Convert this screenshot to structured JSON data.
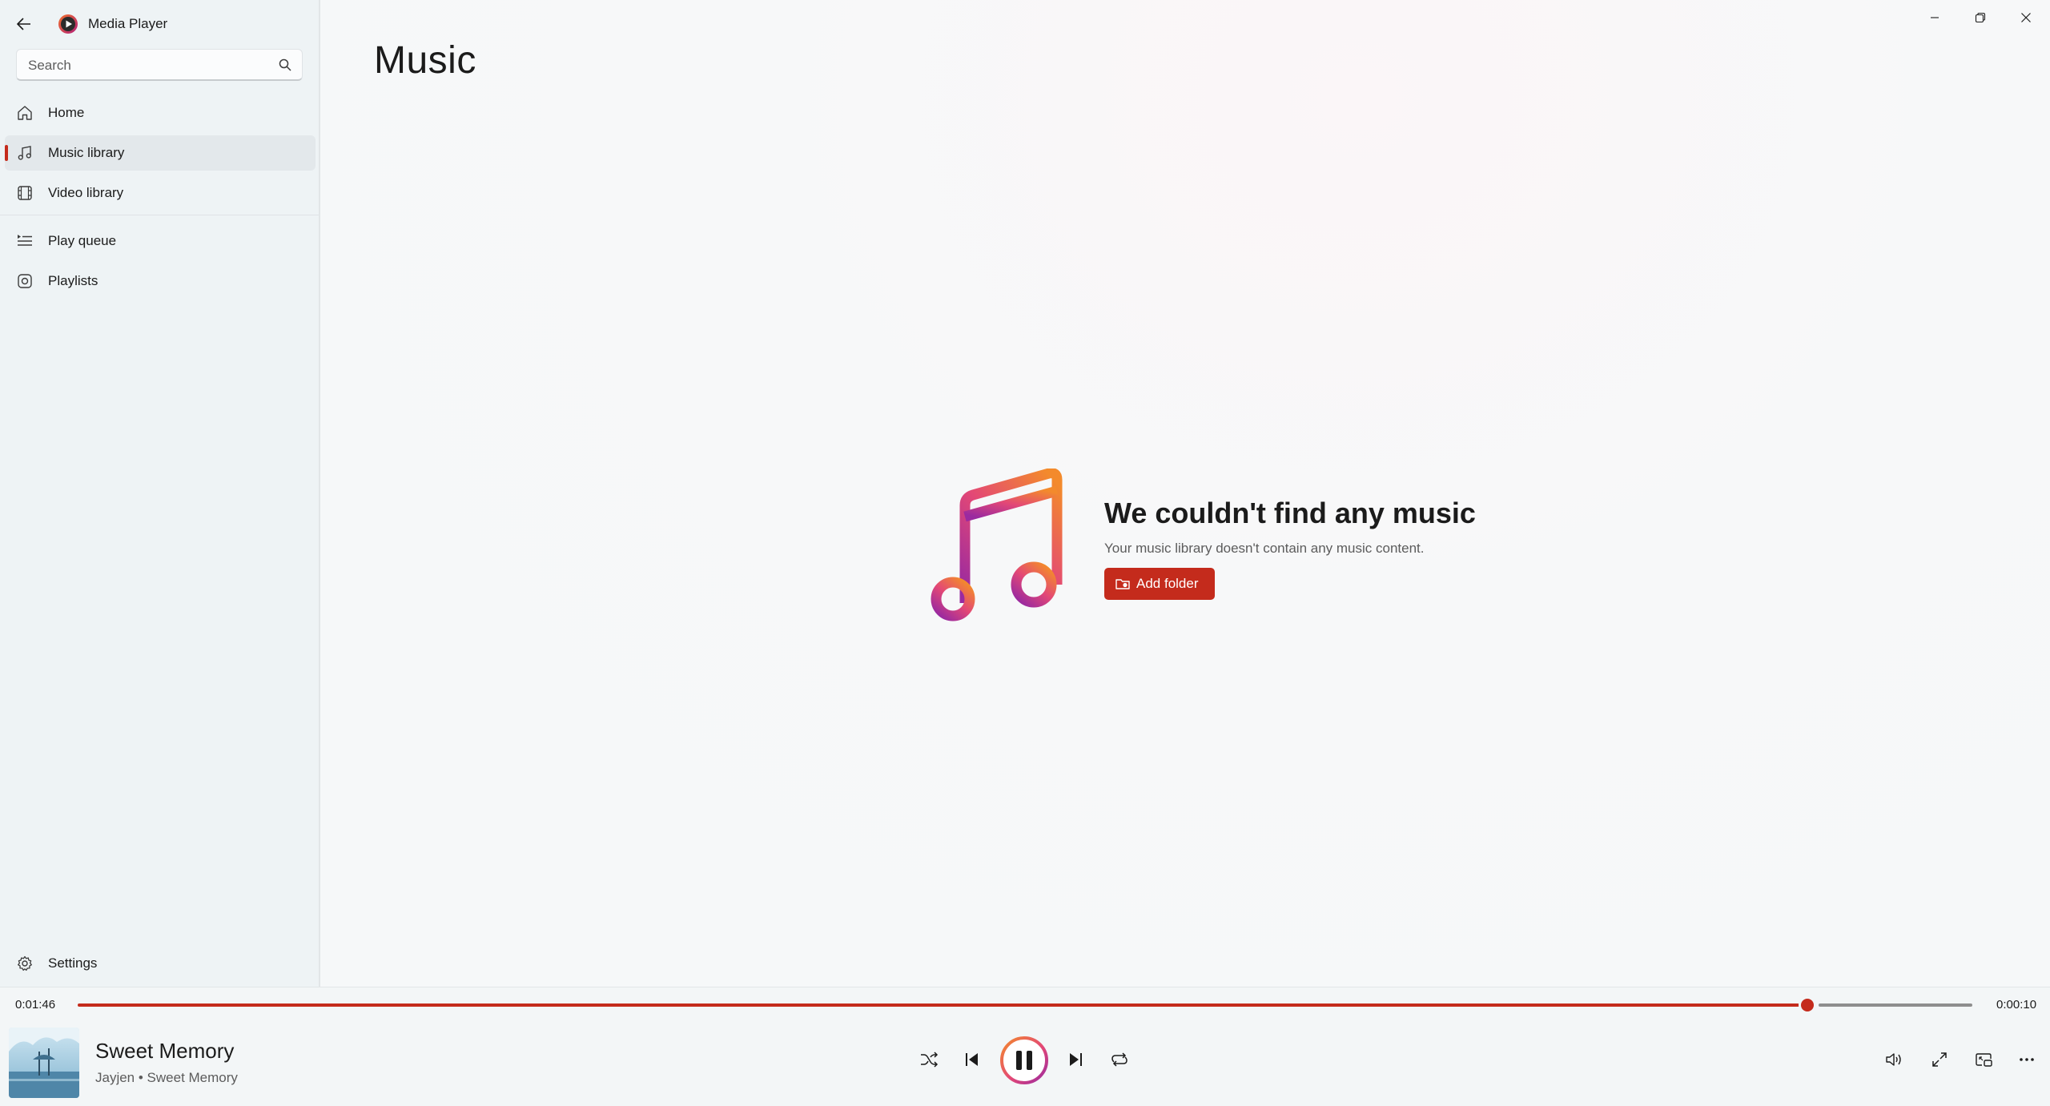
{
  "app": {
    "title": "Media Player"
  },
  "search": {
    "placeholder": "Search"
  },
  "sidebar": {
    "items": [
      {
        "label": "Home",
        "icon": "home-icon"
      },
      {
        "label": "Music library",
        "icon": "music-note-icon",
        "active": true
      },
      {
        "label": "Video library",
        "icon": "film-icon"
      },
      {
        "label": "Play queue",
        "icon": "queue-icon"
      },
      {
        "label": "Playlists",
        "icon": "playlist-icon"
      }
    ],
    "settings_label": "Settings"
  },
  "main": {
    "title": "Music",
    "empty_title": "We couldn't find any music",
    "empty_subtitle": "Your music library doesn't contain any music content.",
    "add_folder_label": "Add folder"
  },
  "player": {
    "elapsed": "0:01:46",
    "remaining": "0:00:10",
    "progress_fraction": 0.913,
    "song_title": "Sweet Memory",
    "song_subtitle": "Jayjen • Sweet Memory",
    "state": "playing"
  },
  "colors": {
    "accent": "#c42b1c",
    "background": "#f6f8f9",
    "sidebar": "#eef3f5"
  }
}
